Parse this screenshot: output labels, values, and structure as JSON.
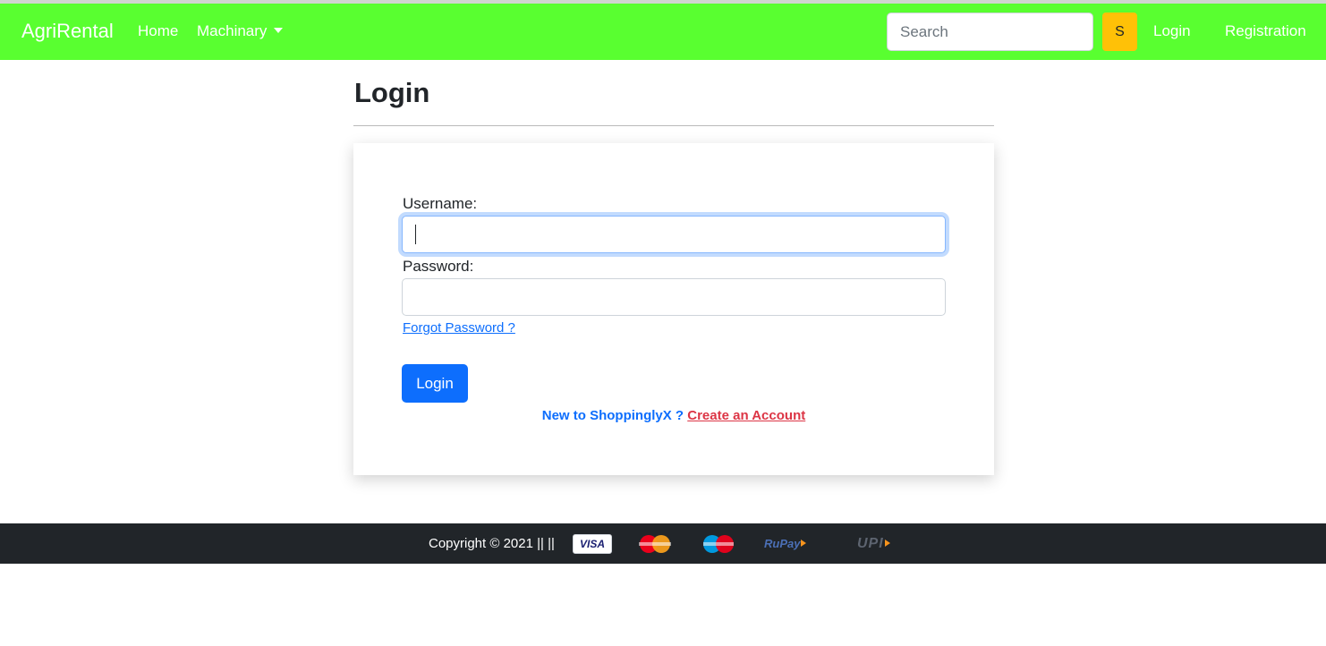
{
  "navbar": {
    "brand": "AgriRental",
    "home_label": "Home",
    "machinery_label": "Machinary",
    "search_placeholder": "Search",
    "search_button_label": "S",
    "login_label": "Login",
    "registration_label": "Registration",
    "bg_color": "#59ff30"
  },
  "page": {
    "title": "Login"
  },
  "form": {
    "username_label": "Username:",
    "username_value": "",
    "password_label": "Password:",
    "password_value": "",
    "forgot_label": "Forgot Password ?",
    "login_button_label": "Login",
    "new_to_text": "New to ShoppinglyX ?",
    "create_account_label": "Create an Account"
  },
  "footer": {
    "copyright": "Copyright © 2021 || ||",
    "payment_logos": [
      "visa-logo",
      "mastercard-logo",
      "maestro-logo",
      "rupay-logo",
      "upi-logo"
    ],
    "logo_text": {
      "visa": "VISA",
      "rupay": "RuPay",
      "upi": "UPI"
    }
  },
  "colors": {
    "primary": "#0d6efd",
    "danger": "#dc3545",
    "warning": "#ffc107",
    "footer_bg": "#212529"
  }
}
